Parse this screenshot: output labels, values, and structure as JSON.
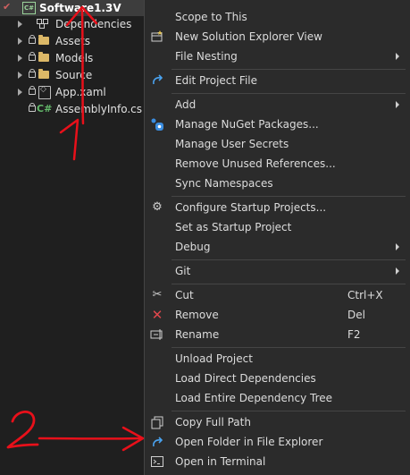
{
  "tree": {
    "project": "Software1.3V",
    "items": [
      {
        "label": "Dependencies"
      },
      {
        "label": "Assets"
      },
      {
        "label": "Models"
      },
      {
        "label": "Source"
      },
      {
        "label": "App.xaml"
      },
      {
        "label": "AssemblyInfo.cs",
        "prefix": "C#"
      }
    ]
  },
  "menu": {
    "items": [
      {
        "label": "Scope to This"
      },
      {
        "label": "New Solution Explorer View"
      },
      {
        "label": "File Nesting"
      },
      {
        "label": "Edit Project File"
      },
      {
        "label": "Add"
      },
      {
        "label": "Manage NuGet Packages..."
      },
      {
        "label": "Manage User Secrets"
      },
      {
        "label": "Remove Unused References..."
      },
      {
        "label": "Sync Namespaces"
      },
      {
        "label": "Configure Startup Projects..."
      },
      {
        "label": "Set as Startup Project"
      },
      {
        "label": "Debug"
      },
      {
        "label": "Git"
      },
      {
        "label": "Cut",
        "shortcut": "Ctrl+X"
      },
      {
        "label": "Remove",
        "shortcut": "Del"
      },
      {
        "label": "Rename",
        "shortcut": "F2"
      },
      {
        "label": "Unload Project"
      },
      {
        "label": "Load Direct Dependencies"
      },
      {
        "label": "Load Entire Dependency Tree"
      },
      {
        "label": "Copy Full Path"
      },
      {
        "label": "Open Folder in File Explorer"
      },
      {
        "label": "Open in Terminal"
      }
    ]
  },
  "annotations": {
    "label_1": "1",
    "label_2": "2",
    "color": "#e8101a"
  }
}
